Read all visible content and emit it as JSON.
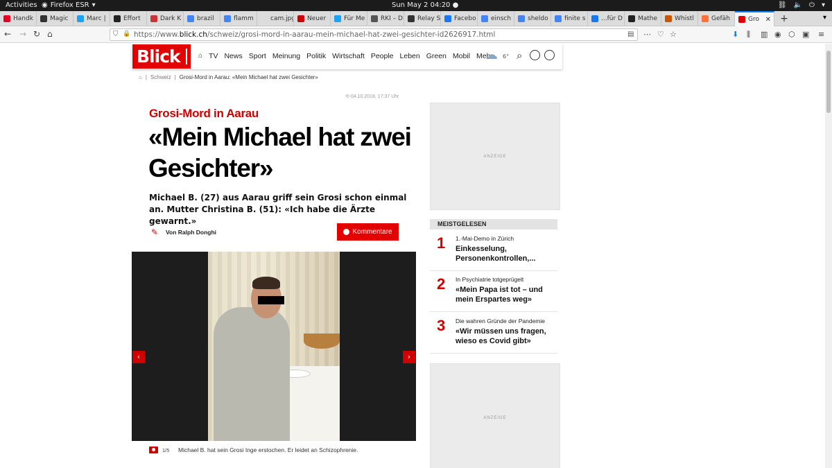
{
  "system_bar": {
    "activities": "Activities",
    "app_name": "Firefox ESR",
    "clock": "Sun May 2  04:20"
  },
  "tabs": [
    {
      "label": "Handk",
      "fav_color": "#e60023"
    },
    {
      "label": "Magic",
      "fav_color": "#333333"
    },
    {
      "label": "Marc |",
      "fav_color": "#1da1f2"
    },
    {
      "label": "Effort",
      "fav_color": "#222222"
    },
    {
      "label": "Dark K",
      "fav_color": "#cc3333"
    },
    {
      "label": "brazil",
      "fav_color": "#4285f4"
    },
    {
      "label": "flamm",
      "fav_color": "#4285f4"
    },
    {
      "label": "cam.jpg (",
      "fav_color": "#dcdcdc"
    },
    {
      "label": "Neuer",
      "fav_color": "#d10000"
    },
    {
      "label": "Für Me",
      "fav_color": "#1da1f2"
    },
    {
      "label": "RKI – D",
      "fav_color": "#555555"
    },
    {
      "label": "Relay S",
      "fav_color": "#333333"
    },
    {
      "label": "Facebo",
      "fav_color": "#1877f2"
    },
    {
      "label": "einsch",
      "fav_color": "#4285f4"
    },
    {
      "label": "sheldo",
      "fav_color": "#4285f4"
    },
    {
      "label": "finite s",
      "fav_color": "#4285f4"
    },
    {
      "label": "...für D",
      "fav_color": "#1877f2"
    },
    {
      "label": "Mathe",
      "fav_color": "#222222"
    },
    {
      "label": "Whistl",
      "fav_color": "#cc5500"
    },
    {
      "label": "Gefäh",
      "fav_color": "#ff7139"
    },
    {
      "label": "Gro",
      "fav_color": "#e20000",
      "active": true
    }
  ],
  "urlbar": {
    "prefix": "https://www.",
    "domain": "blick.ch",
    "path": "/schweiz/grosi-mord-in-aarau-mein-michael-hat-zwei-gesichter-id2626917.html"
  },
  "blick": {
    "logo": "Blick",
    "nav": [
      "TV",
      "News",
      "Sport",
      "Meinung",
      "Politik",
      "Wirtschaft",
      "People",
      "Leben",
      "Green",
      "Mobil",
      "Mehr"
    ],
    "temperature": "6°"
  },
  "breadcrumb": {
    "section": "Schweiz",
    "current": "Grosi-Mord in Aarau: «Mein Michael hat zwei Gesichter»"
  },
  "article": {
    "date": "04.10.2018, 17:37 Uhr",
    "kicker": "Grosi-Mord in Aarau",
    "headline": "«Mein Michael hat zwei Gesichter»",
    "lead": "Michael B. (27) aus Aarau griff sein Grosi schon einmal an. Mutter Christina B. (51): «Ich habe die Ärzte gewarnt.»",
    "author": "Von Ralph Donghi",
    "comments_label": "Kommentare",
    "gallery_count": "1/5",
    "caption": "Michael B. hat sein Grosi Inge erstochen. Er leidet an Schizophrenie."
  },
  "sidebar": {
    "ad_label": "ANZEIGE",
    "most_read_title": "MEISTGELESEN",
    "most_read": [
      {
        "rank": "1",
        "kicker": "1.-Mai-Demo in Zürich",
        "title": "Einkesselung, Personenkontrollen,..."
      },
      {
        "rank": "2",
        "kicker": "In Psychiatrie totgeprügelt",
        "title": "«Mein Papa ist tot – und mein Erspartes weg»"
      },
      {
        "rank": "3",
        "kicker": "Die wahren Gründe der Pandemie",
        "title": "«Wir müssen uns fragen, wieso es Covid gibt»"
      }
    ]
  },
  "colors": {
    "brand_red": "#e20000",
    "firefox_accent": "#0a84ff"
  }
}
